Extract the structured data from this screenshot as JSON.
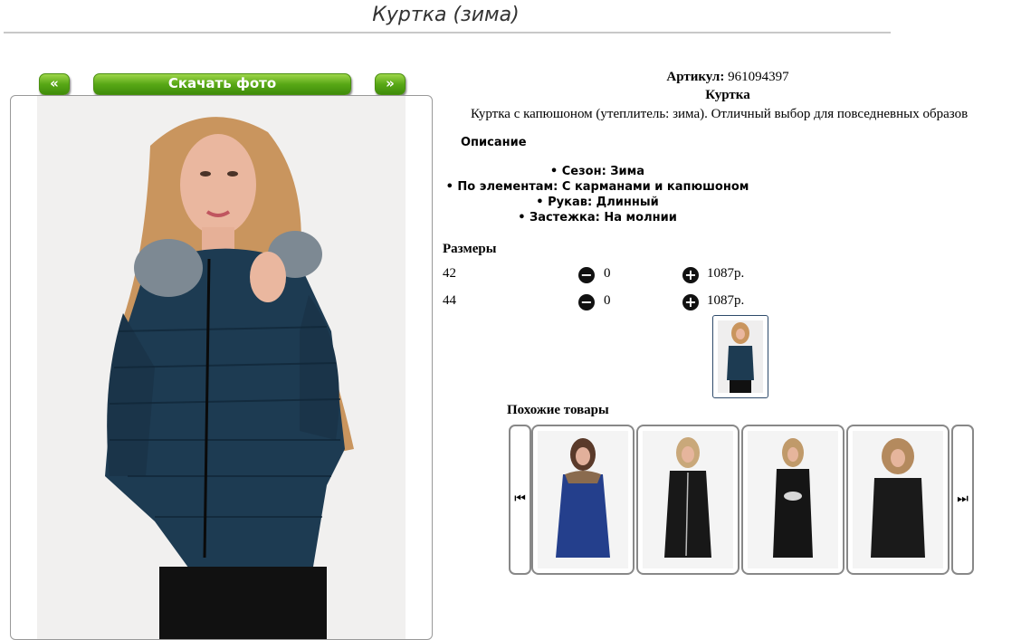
{
  "header": {
    "title": "Куртка (зима)"
  },
  "gallery": {
    "prev_label": "«",
    "next_label": "»",
    "download_label": "Скачать фото"
  },
  "product": {
    "sku_label": "Артикул:",
    "sku_value": "961094397",
    "name": "Куртка",
    "description": "Куртка с капюшоном (утеплитель: зима). Отличный выбор для повседневных образов"
  },
  "description_section": {
    "title": "Описание",
    "items": [
      "• Сезон: Зима",
      "• По элементам: С карманами и капюшоном",
      "• Рукав: Длинный",
      "• Застежка: На молнии"
    ]
  },
  "sizes": {
    "title": "Размеры",
    "rows": [
      {
        "size": "42",
        "qty": "0",
        "price": "1087р."
      },
      {
        "size": "44",
        "qty": "0",
        "price": "1087р."
      }
    ]
  },
  "similar": {
    "title": "Похожие товары"
  },
  "colors": {
    "button_green": "#58a816",
    "jacket_navy": "#1d3b52",
    "jacket_blue": "#243f8c",
    "jacket_black": "#181818"
  }
}
